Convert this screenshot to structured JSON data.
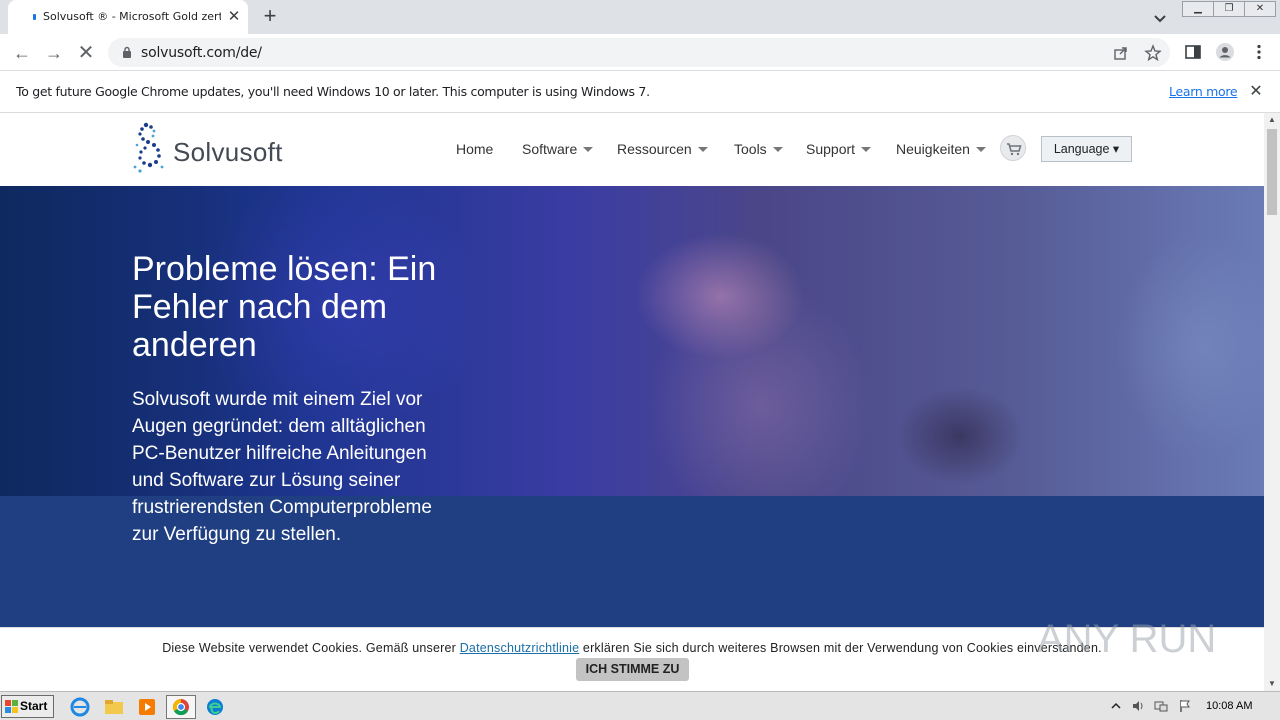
{
  "browser": {
    "tab_title": "Solvusoft ® - Microsoft Gold zertifiziert",
    "url": "solvusoft.com/de/",
    "infobar_text": "To get future Google Chrome updates, you'll need Windows 10 or later. This computer is using Windows 7.",
    "infobar_link": "Learn more"
  },
  "site": {
    "logo_text": "Solvusoft",
    "nav": {
      "home": "Home",
      "software": "Software",
      "ressourcen": "Ressourcen",
      "tools": "Tools",
      "support": "Support",
      "neuigkeiten": "Neuigkeiten"
    },
    "language_button": "Language ▾"
  },
  "hero": {
    "title": "Probleme lösen: Ein Fehler nach dem anderen",
    "text": "Solvusoft wurde mit einem Ziel vor Augen gegründet: dem alltäglichen PC-Benutzer hilfreiche Anleitungen und Software zur Lösung seiner frustrierendsten Computerprobleme zur Verfügung zu stellen."
  },
  "cookie": {
    "text_before": "Diese Website verwendet Cookies. Gemäß unserer ",
    "link": "Datenschutzrichtlinie",
    "text_after": " erklären Sie sich durch weiteres Browsen mit der Verwendung von Cookies einverstanden.",
    "button": "ICH STIMME ZU"
  },
  "watermark": "ANY RUN",
  "taskbar": {
    "start": "Start",
    "clock": "10:08 AM"
  },
  "colors": {
    "hero_blue": "#1f3f82",
    "link_blue": "#1a73e8",
    "logo_gray": "#444a54"
  }
}
